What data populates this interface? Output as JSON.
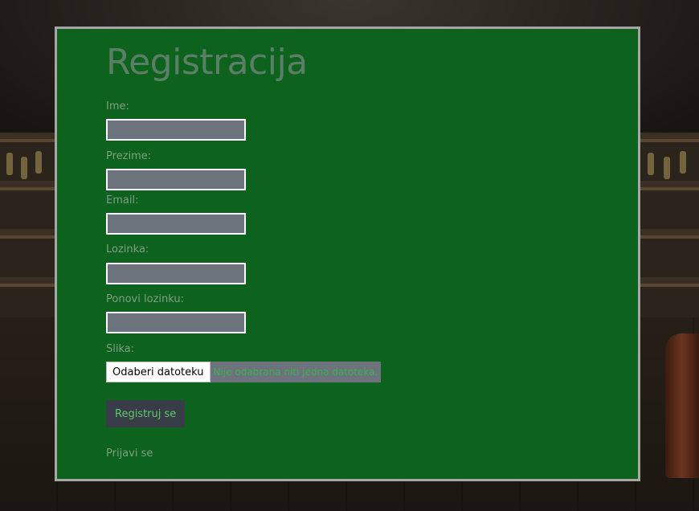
{
  "form": {
    "title": "Registracija",
    "fields": [
      {
        "label": "Ime:",
        "value": ""
      },
      {
        "label": "Prezime:",
        "value": ""
      },
      {
        "label": "Email:",
        "value": ""
      },
      {
        "label": "Lozinka:",
        "value": ""
      },
      {
        "label": "Ponovi lozinku:",
        "value": ""
      }
    ],
    "image_label": "Slika:",
    "file_button": "Odaberi datoteku",
    "file_status": "Nije odabrana niti jedna datoteka.",
    "submit_label": "Registruj se",
    "login_link": "Prijavi se"
  },
  "colors": {
    "panel": "#0d621d",
    "panel_border": "#a6a6a6",
    "input_bg": "#6c737c",
    "button_bg": "#373c47",
    "button_text": "#5cc86b"
  }
}
